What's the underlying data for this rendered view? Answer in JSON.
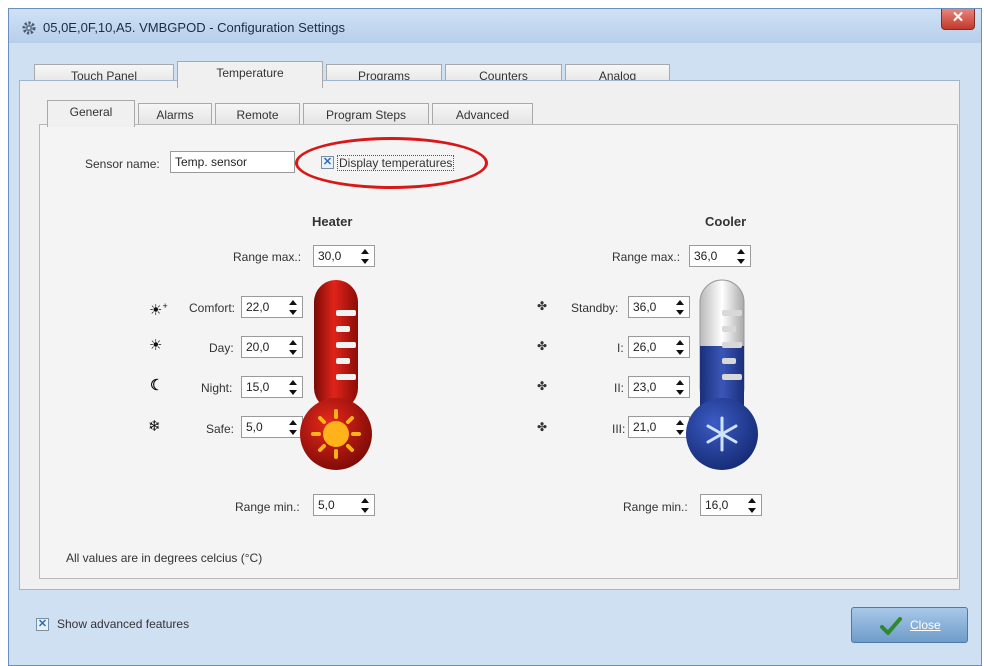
{
  "window": {
    "title": "05,0E,0F,10,A5. VMBGPOD - Configuration Settings",
    "close_glyph": "✕"
  },
  "main_tabs": [
    {
      "label": "Touch Panel",
      "active": false
    },
    {
      "label": "Temperature",
      "active": true
    },
    {
      "label": "Programs",
      "active": false
    },
    {
      "label": "Counters",
      "active": false
    },
    {
      "label": "Analog",
      "active": false
    }
  ],
  "sub_tabs": [
    {
      "label": "General",
      "active": true
    },
    {
      "label": "Alarms",
      "active": false
    },
    {
      "label": "Remote",
      "active": false
    },
    {
      "label": "Program Steps",
      "active": false
    },
    {
      "label": "Advanced",
      "active": false
    }
  ],
  "general": {
    "sensor_name_label": "Sensor name:",
    "sensor_name_value": "Temp. sensor",
    "display_temps_label": "Display temperatures",
    "display_temps_checked": true,
    "footnote": "All values are in degrees celcius (°C)"
  },
  "heater": {
    "title": "Heater",
    "range_max_label": "Range max.:",
    "range_max": "30,0",
    "range_min_label": "Range min.:",
    "range_min": "5,0",
    "rows": [
      {
        "icon": "sun-plus-icon",
        "label": "Comfort:",
        "value": "22,0"
      },
      {
        "icon": "sun-icon",
        "label": "Day:",
        "value": "20,0"
      },
      {
        "icon": "moon-icon",
        "label": "Night:",
        "value": "15,0"
      },
      {
        "icon": "snowflake-icon",
        "label": "Safe:",
        "value": "5,0"
      }
    ],
    "color": "#c0140f"
  },
  "cooler": {
    "title": "Cooler",
    "range_max_label": "Range max.:",
    "range_max": "36,0",
    "range_min_label": "Range min.:",
    "range_min": "16,0",
    "rows": [
      {
        "icon": "fan-off-icon",
        "label": "Standby:",
        "value": "36,0"
      },
      {
        "icon": "fan-speed-1-icon",
        "label": "I:",
        "value": "26,0"
      },
      {
        "icon": "fan-speed-2-icon",
        "label": "II:",
        "value": "23,0"
      },
      {
        "icon": "fan-speed-3-icon",
        "label": "III:",
        "value": "21,0"
      }
    ],
    "color": "#2c4aa8"
  },
  "footer": {
    "advanced_label": "Show advanced features",
    "advanced_checked": true,
    "close_label": "Close"
  }
}
